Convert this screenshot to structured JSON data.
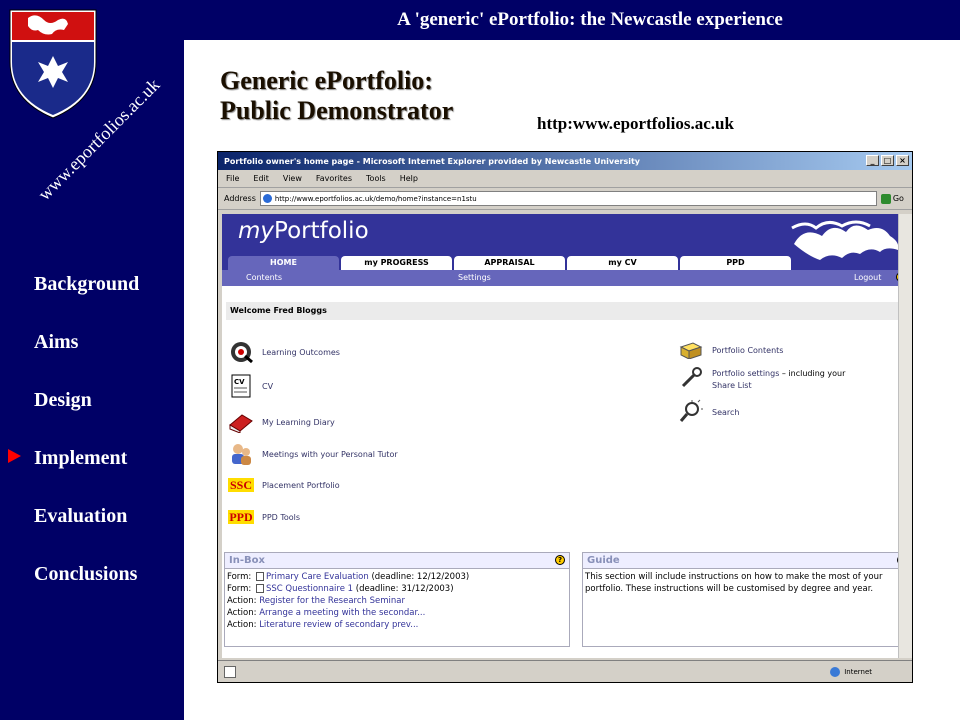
{
  "slide": {
    "title": "A 'generic' ePortfolio: the Newcastle experience",
    "side_url": "www.eportfolios.ac.uk",
    "heading_line1": "Generic ePortfolio:",
    "heading_line2": "Public Demonstrator",
    "heading_url": "http:www.eportfolios.ac.uk",
    "nav": [
      "Background",
      "Aims",
      "Design",
      "Implement",
      "Evaluation",
      "Conclusions"
    ],
    "active_nav": "Implement",
    "colors": {
      "band": "#000066",
      "marker": "#ff0000"
    }
  },
  "browser": {
    "window_title": "Portfolio owner's home page - Microsoft Internet Explorer provided by Newcastle University",
    "menu": [
      "File",
      "Edit",
      "View",
      "Favorites",
      "Tools",
      "Help"
    ],
    "address_label": "Address",
    "address_value": "http://www.eportfolios.ac.uk/demo/home?instance=n1stu",
    "go_label": "Go",
    "status_zone": "Internet"
  },
  "app": {
    "logo_prefix": "my",
    "logo_suffix": "Portfolio",
    "tabs": [
      "HOME",
      "my PROGRESS",
      "APPRAISAL",
      "my CV",
      "PPD"
    ],
    "active_tab": "HOME",
    "subnav": {
      "contents": "Contents",
      "settings": "Settings",
      "logout": "Logout",
      "help": "?"
    },
    "welcome": "Welcome Fred Bloggs",
    "left_links": [
      {
        "label": "Learning Outcomes",
        "icon": "target-icon"
      },
      {
        "label": "CV",
        "icon": "cv-document-icon"
      },
      {
        "label": "My Learning Diary",
        "icon": "diary-book-icon"
      },
      {
        "label": "Meetings with your Personal Tutor",
        "icon": "people-icon"
      },
      {
        "label": "Placement Portfolio",
        "icon": "ssc-icon",
        "icon_text": "SSC"
      },
      {
        "label": "PPD Tools",
        "icon": "ppd-icon",
        "icon_text": "PPD"
      }
    ],
    "right_links": [
      {
        "label": "Portfolio Contents",
        "icon": "folder-box-icon"
      },
      {
        "label": "Portfolio settings",
        "suffix": " – including your",
        "line2": "Share List",
        "icon": "wrench-icon"
      },
      {
        "label": "Search",
        "icon": "magnifier-icon"
      }
    ],
    "inbox": {
      "title": "In-Box",
      "items": [
        {
          "kind": "Form:",
          "link": "Primary Care Evaluation",
          "note": " (deadline: 12/12/2003)",
          "doc": true
        },
        {
          "kind": "Form:",
          "link": "SSC Questionnaire 1",
          "note": " (deadline: 31/12/2003)",
          "doc": true
        },
        {
          "kind": "Action:",
          "link": "Register for the Research Seminar",
          "note": "",
          "doc": false
        },
        {
          "kind": "Action:",
          "link": "Arrange a meeting with the secondar...",
          "note": "",
          "doc": false
        },
        {
          "kind": "Action:",
          "link": "Literature review of secondary prev...",
          "note": "",
          "doc": false
        }
      ]
    },
    "guide": {
      "title": "Guide",
      "text": "This section will include instructions on how to make the most of your portfolio. These instructions will be customised by degree and year."
    }
  }
}
